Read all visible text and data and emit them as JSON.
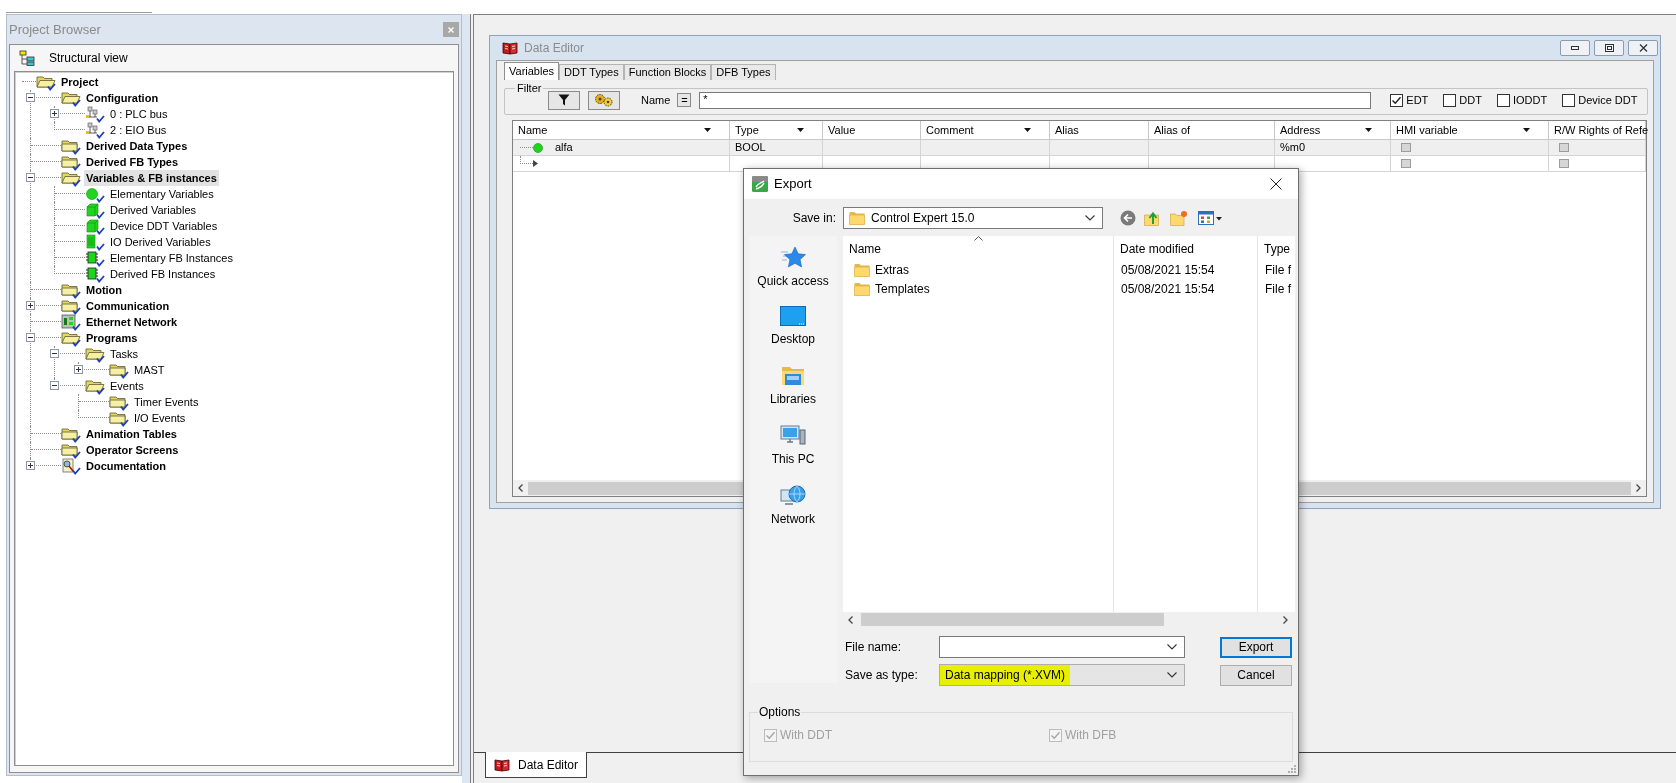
{
  "project_browser": {
    "title": "Project Browser",
    "view_label": "Structural view",
    "tree": [
      {
        "label": "Project",
        "kind": "folder",
        "selected": false,
        "children": [
          {
            "label": "Configuration",
            "kind": "folder",
            "expanded": true,
            "selected": false,
            "children": [
              {
                "label": "0 : PLC bus",
                "kind": "bus",
                "expanded": false,
                "selected": false
              },
              {
                "label": "2 : EIO Bus",
                "kind": "bus",
                "selected": false
              }
            ]
          },
          {
            "label": "Derived Data Types",
            "kind": "folder",
            "selected": false
          },
          {
            "label": "Derived FB Types",
            "kind": "folder",
            "selected": false
          },
          {
            "label": "Variables & FB instances",
            "kind": "folder",
            "expanded": true,
            "selected": true,
            "children": [
              {
                "label": "Elementary Variables",
                "kind": "elementary-variable",
                "selected": false
              },
              {
                "label": "Derived Variables",
                "kind": "derived-variable",
                "selected": false
              },
              {
                "label": "Device DDT Variables",
                "kind": "derived-variable",
                "selected": false
              },
              {
                "label": "IO Derived Variables",
                "kind": "io-variable",
                "selected": false
              },
              {
                "label": "Elementary FB Instances",
                "kind": "fb-instance",
                "selected": false
              },
              {
                "label": "Derived FB Instances",
                "kind": "fb-instance",
                "selected": false
              }
            ]
          },
          {
            "label": "Motion",
            "kind": "folder",
            "selected": false
          },
          {
            "label": "Communication",
            "kind": "folder",
            "expanded": false,
            "selected": false
          },
          {
            "label": "Ethernet Network",
            "kind": "network",
            "selected": false
          },
          {
            "label": "Programs",
            "kind": "folder",
            "expanded": true,
            "selected": false,
            "children": [
              {
                "label": "Tasks",
                "kind": "folder",
                "expanded": true,
                "selected": false,
                "children": [
                  {
                    "label": "MAST",
                    "kind": "folder",
                    "expanded": false,
                    "selected": false
                  }
                ]
              },
              {
                "label": "Events",
                "kind": "folder",
                "expanded": true,
                "selected": false,
                "children": [
                  {
                    "label": "Timer Events",
                    "kind": "folder",
                    "selected": false
                  },
                  {
                    "label": "I/O Events",
                    "kind": "folder",
                    "selected": false
                  }
                ]
              }
            ]
          },
          {
            "label": "Animation Tables",
            "kind": "folder",
            "selected": false
          },
          {
            "label": "Operator Screens",
            "kind": "folder",
            "selected": false
          },
          {
            "label": "Documentation",
            "kind": "documentation",
            "expanded": false,
            "selected": false
          }
        ]
      }
    ]
  },
  "data_editor": {
    "title": "Data Editor",
    "tabs": [
      {
        "label": "Variables",
        "selected": true
      },
      {
        "label": "DDT Types",
        "selected": false
      },
      {
        "label": "Function Blocks",
        "selected": false
      },
      {
        "label": "DFB Types",
        "selected": false
      }
    ],
    "filter": {
      "label": "Filter",
      "name_label": "Name",
      "operator": "=",
      "value": "*",
      "checkboxes": [
        {
          "label": "EDT",
          "checked": true
        },
        {
          "label": "DDT",
          "checked": false
        },
        {
          "label": "IODDT",
          "checked": false
        },
        {
          "label": "Device DDT",
          "checked": false
        }
      ]
    },
    "table": {
      "columns": [
        {
          "label": "Name",
          "dropdown": true
        },
        {
          "label": "Type",
          "dropdown": true
        },
        {
          "label": "Value",
          "dropdown": false
        },
        {
          "label": "Comment",
          "dropdown": true
        },
        {
          "label": "Alias",
          "dropdown": false
        },
        {
          "label": "Alias of",
          "dropdown": false
        },
        {
          "label": "Address",
          "dropdown": true
        },
        {
          "label": "HMI variable",
          "dropdown": true
        },
        {
          "label": "R/W Rights of Refe"
        }
      ],
      "rows": [
        {
          "kind": "variable",
          "selected": true,
          "name": "alfa",
          "type": "BOOL",
          "address": "%m0",
          "hmi_variable": false,
          "rw_rights": false
        },
        {
          "kind": "new-entry",
          "selected": false,
          "hmi_variable": false,
          "rw_rights": false
        }
      ]
    }
  },
  "export_dialog": {
    "title": "Export",
    "save_in": {
      "label": "Save in:",
      "value": "Control Expert 15.0"
    },
    "places": [
      {
        "label": "Quick access",
        "kind": "quick-access"
      },
      {
        "label": "Desktop",
        "kind": "desktop"
      },
      {
        "label": "Libraries",
        "kind": "libraries"
      },
      {
        "label": "This PC",
        "kind": "computer"
      },
      {
        "label": "Network",
        "kind": "network"
      }
    ],
    "file_list": {
      "columns": [
        {
          "label": "Name",
          "sorted": true
        },
        {
          "label": "Date modified",
          "sorted": false
        },
        {
          "label": "Type",
          "sorted": false
        }
      ],
      "rows": [
        {
          "name": "Extras",
          "date_modified": "05/08/2021 15:54",
          "type": "File f"
        },
        {
          "name": "Templates",
          "date_modified": "05/08/2021 15:54",
          "type": "File f"
        }
      ]
    },
    "file_name": {
      "label": "File name:"
    },
    "save_as_type": {
      "label": "Save as type:",
      "value": "Data mapping (*.XVM)",
      "highlighted": true
    },
    "buttons": [
      {
        "label": "Export",
        "default": true
      },
      {
        "label": "Cancel",
        "default": false
      }
    ],
    "options": {
      "title": "Options",
      "checkboxes": [
        {
          "label": "With DDT",
          "checked": true,
          "disabled": true
        },
        {
          "label": "With DFB",
          "checked": true,
          "disabled": true
        }
      ]
    }
  },
  "document_tabs": [
    {
      "label": "Data Editor",
      "selected": true
    }
  ]
}
